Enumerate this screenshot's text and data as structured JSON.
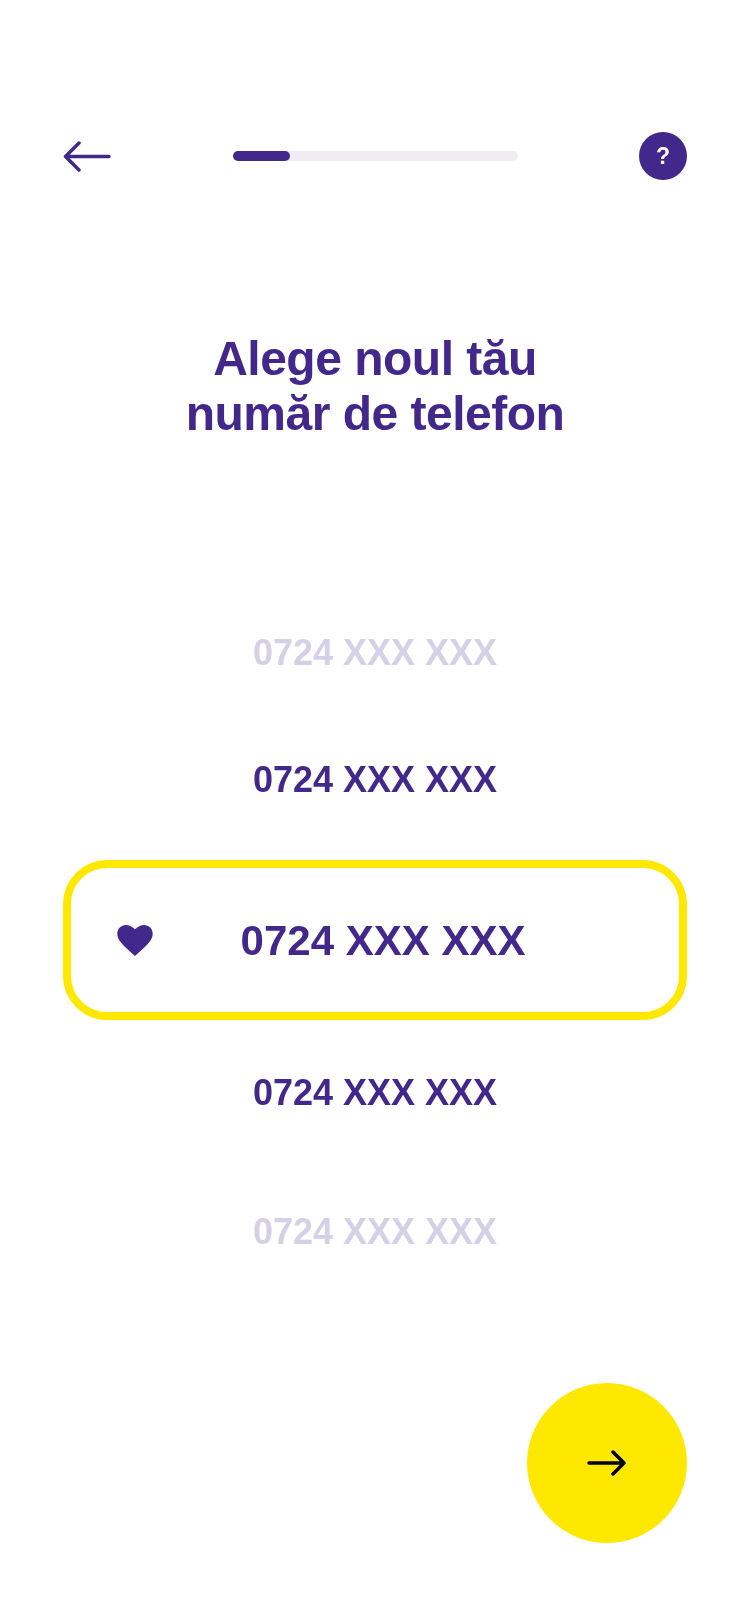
{
  "progress": {
    "level": 0.2
  },
  "help_button": {
    "label": "?"
  },
  "title": "Alege noul tău număr de telefon",
  "numbers": [
    {
      "number": "0724 XXX XXX",
      "selected": false,
      "dimmed": true
    },
    {
      "number": "0724 XXX XXX",
      "selected": false,
      "dimmed": false
    },
    {
      "number": "0724 XXX XXX",
      "selected": true,
      "dimmed": false
    },
    {
      "number": "0724 XXX XXX",
      "selected": false,
      "dimmed": false
    },
    {
      "number": "0724 XXX XXX",
      "selected": false,
      "dimmed": true
    }
  ]
}
